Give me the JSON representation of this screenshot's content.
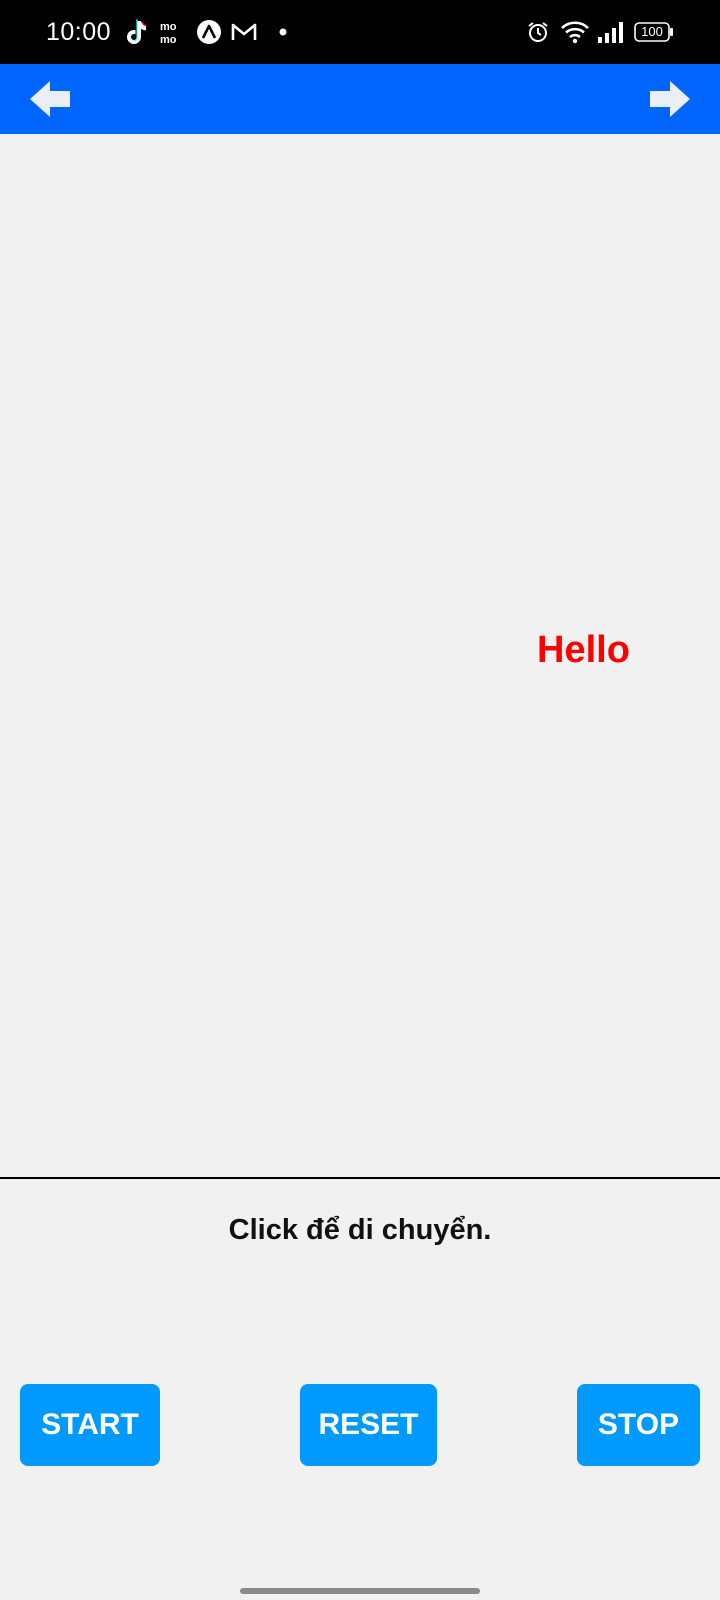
{
  "status_bar": {
    "time": "10:00",
    "battery_level": "100",
    "notification_icons": [
      "tiktok-icon",
      "momo-icon",
      "expo-icon",
      "gmail-icon",
      "dot-icon"
    ],
    "system_icons": [
      "alarm-icon",
      "wifi-icon",
      "signal-icon",
      "battery-icon"
    ]
  },
  "app_bar": {
    "color": "#0066ff",
    "back_icon": "arrow-left-icon",
    "forward_icon": "arrow-right-icon"
  },
  "content": {
    "hello_text": "Hello",
    "hello_color": "#ff0000",
    "instruction": "Click để di chuyển."
  },
  "buttons": {
    "start_label": "START",
    "reset_label": "RESET",
    "stop_label": "STOP",
    "color": "#0099ff"
  }
}
